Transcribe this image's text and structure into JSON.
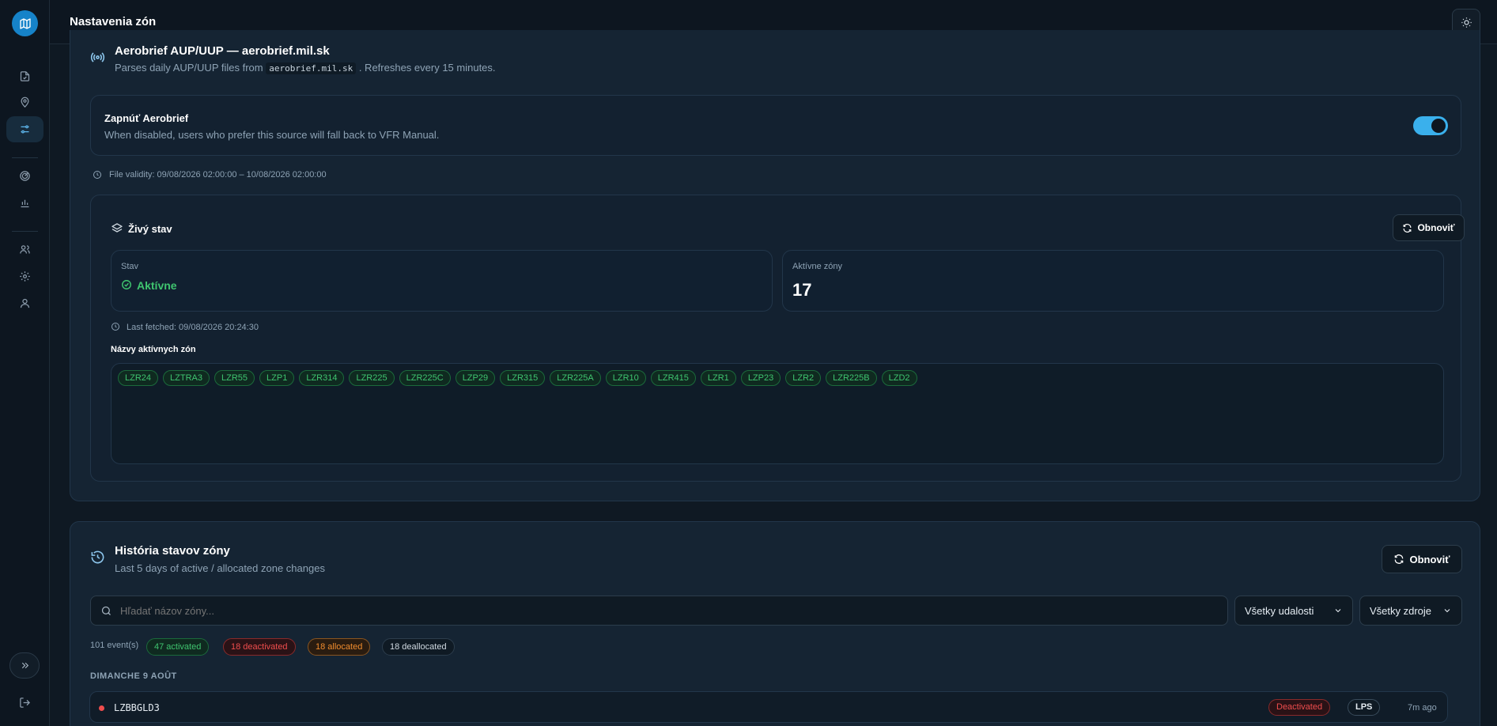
{
  "app": {
    "title": "Nastavenia zón"
  },
  "colors": {
    "accent": "#3ab0ec",
    "active_green": "#3fc46f",
    "deactivated_red": "#ef4d4d",
    "allocated_orange": "#f08c2e"
  },
  "nav": {
    "icons": [
      "document-icon",
      "map-pin-icon",
      "sliders-icon",
      "radar-icon",
      "bar-chart-icon",
      "users-icon",
      "gear-icon",
      "user-icon"
    ]
  },
  "source": {
    "title": "Aerobrief AUP/UUP — aerobrief.mil.sk",
    "desc_prefix": "Parses daily AUP/UUP files from",
    "desc_code": "aerobrief.mil.sk",
    "desc_suffix": ". Refreshes every 15 minutes.",
    "toggle_title": "Zapnúť Aerobrief",
    "toggle_desc": "When disabled, users who prefer this source will fall back to VFR Manual.",
    "toggle_on": true,
    "validity": "File validity: 09/08/2026 02:00:00 – 10/08/2026 02:00:00"
  },
  "live": {
    "title": "Živý stav",
    "refresh_label": "Obnoviť",
    "status_label": "Stav",
    "status_value": "Aktívne",
    "active_label": "Aktívne zóny",
    "active_count": "17",
    "last_fetched": "Last fetched: 09/08/2026 20:24:30",
    "zones_label": "Názvy aktívnych zón",
    "zones": [
      "LZR24",
      "LZTRA3",
      "LZR55",
      "LZP1",
      "LZR314",
      "LZR225",
      "LZR225C",
      "LZP29",
      "LZR315",
      "LZR225A",
      "LZR10",
      "LZR415",
      "LZR1",
      "LZP23",
      "LZR2",
      "LZR225B",
      "LZD2"
    ]
  },
  "history": {
    "title": "História stavov zóny",
    "subtitle": "Last 5 days of active / allocated zone changes",
    "refresh_label": "Obnoviť",
    "search_placeholder": "Hľadať názov zóny...",
    "events_filter": "Všetky udalosti",
    "sources_filter": "Všetky zdroje",
    "event_count": "101 event(s)",
    "badges": {
      "activated": "47 activated",
      "deactivated": "18 deactivated",
      "allocated": "18 allocated",
      "deallocated": "18 deallocated"
    },
    "day_heading": "DIMANCHE 9 AOÛT",
    "rows": [
      {
        "zone": "LZBBGLD3",
        "status": "Deactivated",
        "source": "LPS",
        "time": "7m ago"
      }
    ]
  }
}
